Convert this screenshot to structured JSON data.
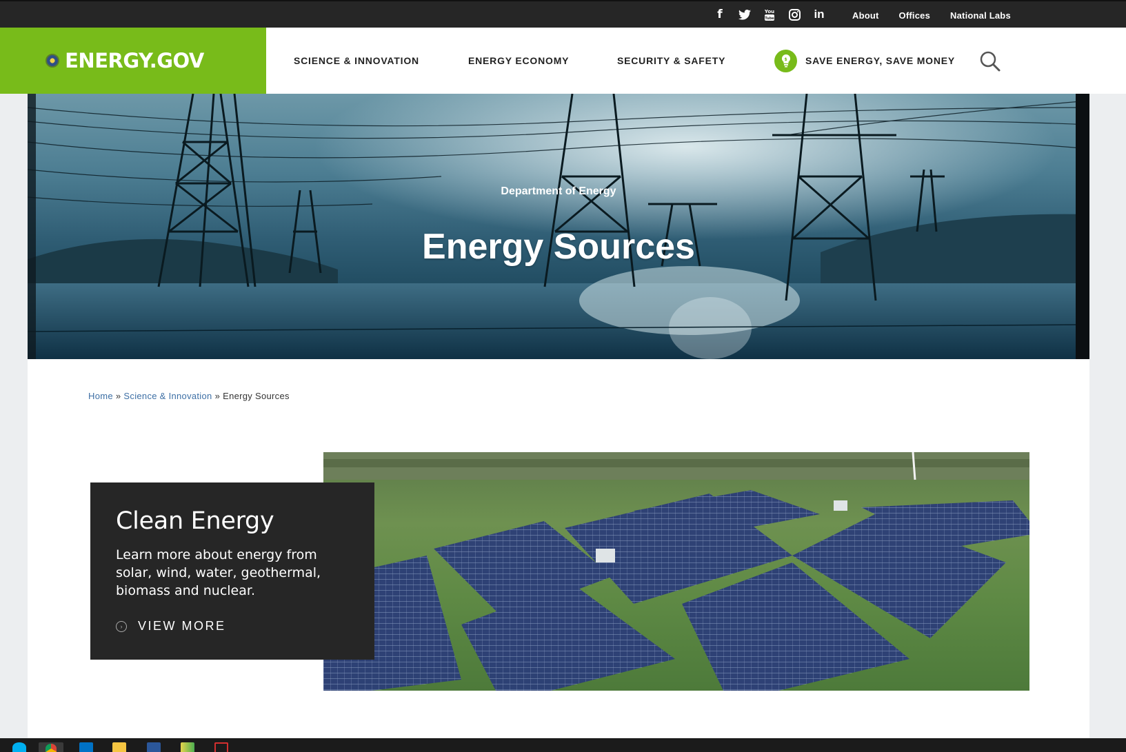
{
  "utility": {
    "social": [
      {
        "name": "facebook-icon",
        "glyph": "f"
      },
      {
        "name": "twitter-icon",
        "glyph": "🐦"
      },
      {
        "name": "youtube-icon",
        "glyph": "▶"
      },
      {
        "name": "instagram-icon",
        "glyph": "◙"
      },
      {
        "name": "linkedin-icon",
        "glyph": "in"
      }
    ],
    "links": {
      "about": "About",
      "offices": "Offices",
      "labs": "National Labs"
    }
  },
  "header": {
    "logo_text": "ENERGY.GOV",
    "nav": {
      "science": "SCIENCE & INNOVATION",
      "economy": "ENERGY ECONOMY",
      "security": "SECURITY & SAFETY",
      "save": "SAVE ENERGY, SAVE MONEY"
    }
  },
  "hero": {
    "supertitle": "Department of Energy",
    "title": "Energy Sources"
  },
  "breadcrumb": {
    "home": "Home",
    "sep": "»",
    "science": "Science & Innovation",
    "current": "Energy Sources"
  },
  "feature": {
    "title": "Clean Energy",
    "description": "Learn more about energy from solar, wind, water, geothermal, biomass and nuclear.",
    "link": "VIEW MORE"
  },
  "colors": {
    "brand_green": "#78bb1a",
    "dark": "#262626",
    "link_blue": "#3d6fa5"
  }
}
